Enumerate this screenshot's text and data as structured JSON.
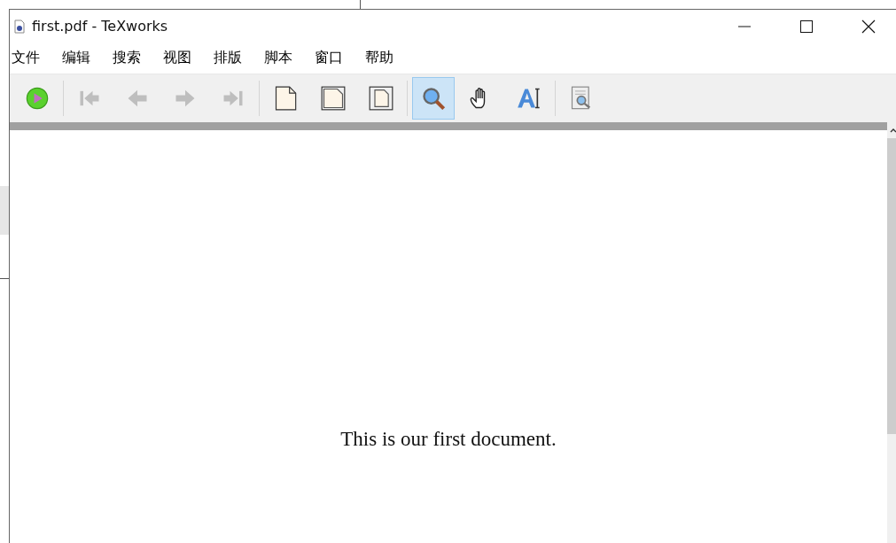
{
  "window": {
    "title": "first.pdf - TeXworks"
  },
  "menu": [
    "文件",
    "编辑",
    "搜索",
    "视图",
    "排版",
    "脚本",
    "窗口",
    "帮助"
  ],
  "toolbar": [
    [
      {
        "kind": "typeset",
        "disabled": false,
        "selected": false
      }
    ],
    [
      {
        "kind": "first",
        "disabled": true,
        "selected": false
      },
      {
        "kind": "prev",
        "disabled": true,
        "selected": false
      },
      {
        "kind": "next",
        "disabled": true,
        "selected": false
      },
      {
        "kind": "last",
        "disabled": true,
        "selected": false
      }
    ],
    [
      {
        "kind": "actual-size",
        "disabled": false,
        "selected": false
      },
      {
        "kind": "fit-width",
        "disabled": false,
        "selected": false
      },
      {
        "kind": "fit-window",
        "disabled": false,
        "selected": false
      }
    ],
    [
      {
        "kind": "magnify",
        "disabled": false,
        "selected": true
      },
      {
        "kind": "scroll",
        "disabled": false,
        "selected": false
      },
      {
        "kind": "select-text",
        "disabled": false,
        "selected": false
      }
    ],
    [
      {
        "kind": "find",
        "disabled": false,
        "selected": false
      }
    ]
  ],
  "document": {
    "text": "This is our first document."
  }
}
